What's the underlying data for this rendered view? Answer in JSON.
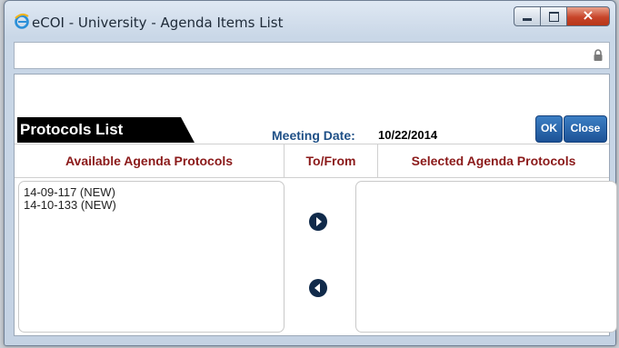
{
  "window": {
    "title": "eCOI - University - Agenda Items List"
  },
  "panel": {
    "title": "Protocols List",
    "meeting_date_label": "Meeting Date:",
    "meeting_date_value": "10/22/2014"
  },
  "buttons": {
    "ok": "OK",
    "close": "Close"
  },
  "columns": {
    "available": "Available Agenda Protocols",
    "to_from": "To/From",
    "selected": "Selected Agenda Protocols"
  },
  "available_protocols": [
    "14-09-117 (NEW)",
    "14-10-133 (NEW)"
  ],
  "selected_protocols": [],
  "icons": {
    "move_right": "arrow-right-icon",
    "move_left": "arrow-left-icon",
    "browser": "ie-icon",
    "lock": "lock-icon"
  },
  "colors": {
    "header_text": "#8b1a1a",
    "meeting_label": "#1e4f86",
    "button_blue": "#1d5296",
    "arrow": "#102a4a"
  }
}
